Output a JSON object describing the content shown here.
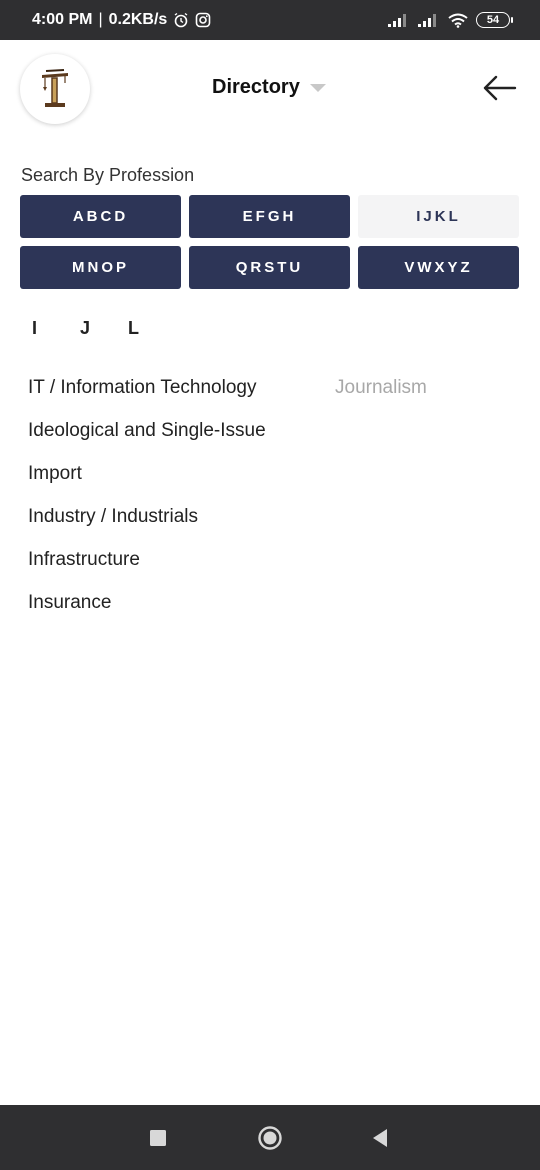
{
  "status_bar": {
    "time": "4:00 PM",
    "separator": "|",
    "speed": "0.2KB/s",
    "battery": "54",
    "icons": [
      "alarm-icon",
      "instagram-icon",
      "signal-icon",
      "signal-icon",
      "wifi-icon",
      "battery-icon"
    ]
  },
  "header": {
    "title": "Directory",
    "logo_icon": "crane-logo-icon",
    "back_icon": "arrow-left-icon"
  },
  "search": {
    "label": "Search By Profession",
    "letter_groups": [
      {
        "label": "ABCD",
        "active": false
      },
      {
        "label": "EFGH",
        "active": false
      },
      {
        "label": "IJKL",
        "active": true
      },
      {
        "label": "MNOP",
        "active": false
      },
      {
        "label": "QRSTU",
        "active": false
      },
      {
        "label": "VWXYZ",
        "active": false
      }
    ],
    "sub_letters": [
      "I",
      "J",
      "L"
    ]
  },
  "professions": {
    "items": [
      "IT / Information Technology",
      "Ideological and Single-Issue",
      "Import",
      "Industry / Industrials",
      "Infrastructure",
      "Insurance"
    ],
    "side_item": "Journalism"
  },
  "nav_bar": {
    "icons": [
      "recent-apps-icon",
      "home-icon",
      "back-triangle-icon"
    ]
  },
  "colors": {
    "status_bar": "#2f2f31",
    "button_dark": "#2d3557",
    "button_active": "#f4f4f5",
    "muted_text": "#a8a8a8"
  }
}
